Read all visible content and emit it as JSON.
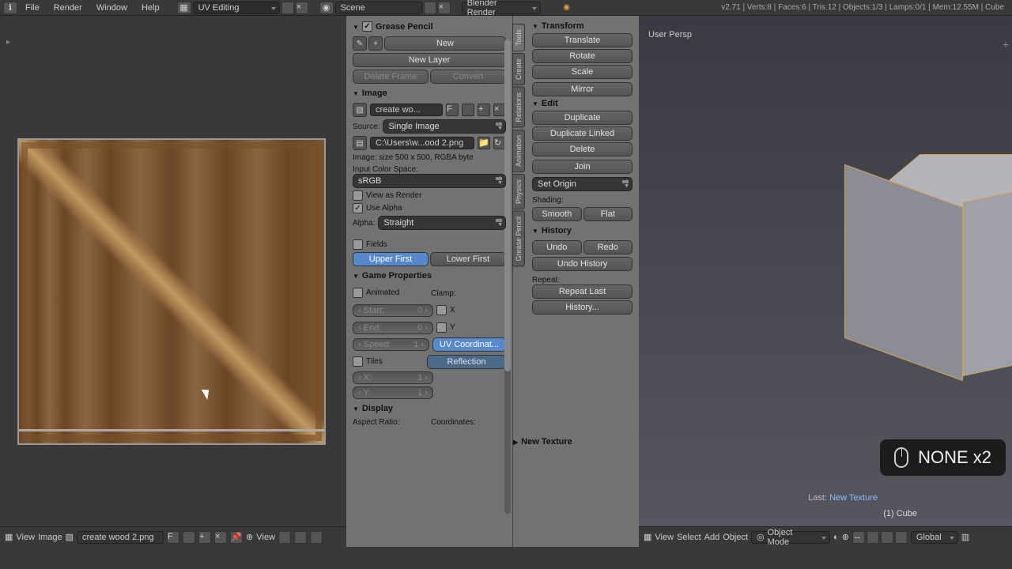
{
  "topbar": {
    "menus": [
      "File",
      "Render",
      "Window",
      "Help"
    ],
    "layout_dropdown": "UV Editing",
    "scene_label": "Scene",
    "engine": "Blender Render",
    "stats": "v2.71 | Verts:8 | Faces:6 | Tris:12 | Objects:1/3 | Lamps:0/1 | Mem:12.55M | Cube"
  },
  "grease": {
    "title": "Grease Pencil",
    "new": "New",
    "new_layer": "New Layer",
    "delete_frame": "Delete Frame",
    "convert": "Convert"
  },
  "image": {
    "title": "Image",
    "name": "create wo...",
    "f_btn": "F",
    "source_lbl": "Source:",
    "source_val": "Single Image",
    "path": "C:\\Users\\w...ood 2.png",
    "info": "Image: size 500 x 500, RGBA byte",
    "ics_lbl": "Input Color Space:",
    "ics_val": "sRGB",
    "view_as_render": "View as Render",
    "use_alpha": "Use Alpha",
    "alpha_lbl": "Alpha:",
    "alpha_val": "Straight",
    "fields": "Fields",
    "upper": "Upper First",
    "lower": "Lower First"
  },
  "game": {
    "title": "Game Properties",
    "animated": "Animated",
    "clamp": "Clamp:",
    "start_lbl": "Start:",
    "start_val": "0",
    "end_lbl": "End:",
    "end_val": "0",
    "speed_lbl": "Speed:",
    "speed_val": "1",
    "x": "X",
    "y": "Y",
    "tiles": "Tiles",
    "xv": "1",
    "yv": "1",
    "uvcoord": "UV Coordinat...",
    "reflection": "Reflection"
  },
  "display": {
    "title": "Display",
    "aspect": "Aspect Ratio:",
    "coords": "Coordinates:"
  },
  "tools": {
    "tabs": [
      "Tools",
      "Create",
      "Relations",
      "Animation",
      "Physics",
      "Grease Pencil"
    ],
    "transform": {
      "title": "Transform",
      "translate": "Translate",
      "rotate": "Rotate",
      "scale": "Scale",
      "mirror": "Mirror"
    },
    "edit": {
      "title": "Edit",
      "duplicate": "Duplicate",
      "dup_linked": "Duplicate Linked",
      "delete": "Delete",
      "join": "Join",
      "set_origin": "Set Origin"
    },
    "shading": {
      "title": "Shading:",
      "smooth": "Smooth",
      "flat": "Flat"
    },
    "history": {
      "title": "History",
      "undo": "Undo",
      "redo": "Redo",
      "undo_hist": "Undo History",
      "repeat_lbl": "Repeat:",
      "repeat_last": "Repeat Last",
      "history": "History..."
    }
  },
  "newtex": {
    "title": "New Texture"
  },
  "viewport": {
    "persp": "User Persp",
    "overlay": "NONE x2",
    "last_op_lbl": "Last:",
    "last_op_val": "New Texture",
    "obj": "(1) Cube"
  },
  "uv_footer": {
    "view": "View",
    "image": "Image",
    "imgname": "create wood 2.png",
    "f": "F"
  },
  "vp_footer": {
    "view": "View",
    "select": "Select",
    "add": "Add",
    "object": "Object",
    "mode": "Object Mode",
    "orient": "Global"
  }
}
